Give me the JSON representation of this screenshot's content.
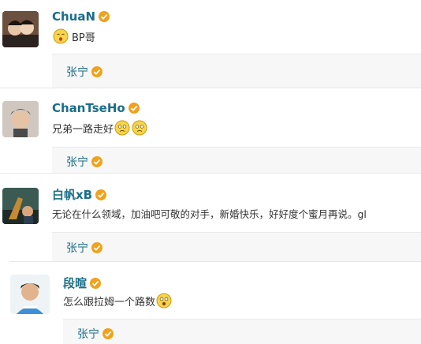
{
  "posts": [
    {
      "username": "ChuaN",
      "verified": true,
      "text_before": "",
      "text_after": "BP哥",
      "emoji_before": "smile-kiss-emoji",
      "emoji_after_count": 0,
      "repost_user": "张宁"
    },
    {
      "username": "ChanTseHo",
      "verified": true,
      "text_before": "兄弟一路走好",
      "emoji_after_count": 2,
      "emoji_after": "sad-face-emoji",
      "repost_user": "张宁"
    },
    {
      "username": "白帆xB",
      "verified": true,
      "text_before": "无论在什么领域，加油吧可敬的对手，新婚快乐，好好度个蜜月再说。gl",
      "emoji_after_count": 0,
      "repost_user": "张宁"
    },
    {
      "username": "段暄",
      "verified": true,
      "text_before": "怎么跟拉姆一个路数",
      "emoji_after_count": 1,
      "emoji_after": "surprised-face-emoji",
      "repost_user": "张宁"
    }
  ],
  "colors": {
    "username": "#1a6e89",
    "badge": "#f0a21c",
    "repost_bg": "#f7f7f7",
    "text": "#333333"
  }
}
